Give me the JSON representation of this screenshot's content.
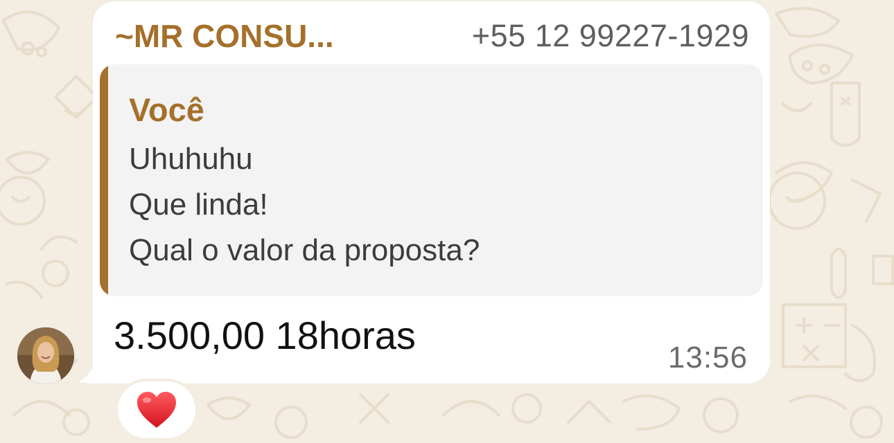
{
  "message": {
    "sender_name": "~MR CONSU...",
    "sender_phone": "+55 12 99227-1929",
    "quoted": {
      "author": "Você",
      "lines": [
        "Uhuhuhu",
        "Que linda!",
        "Qual o valor da proposta?"
      ]
    },
    "text": "3.500,00 18horas",
    "time": "13:56",
    "reaction": "heart-icon"
  },
  "colors": {
    "wallpaper": "#f3ede2",
    "bubble": "#ffffff",
    "accent": "#a4702b",
    "quote_bg": "#f4f3f3",
    "reaction_heart": "#e8202a"
  }
}
